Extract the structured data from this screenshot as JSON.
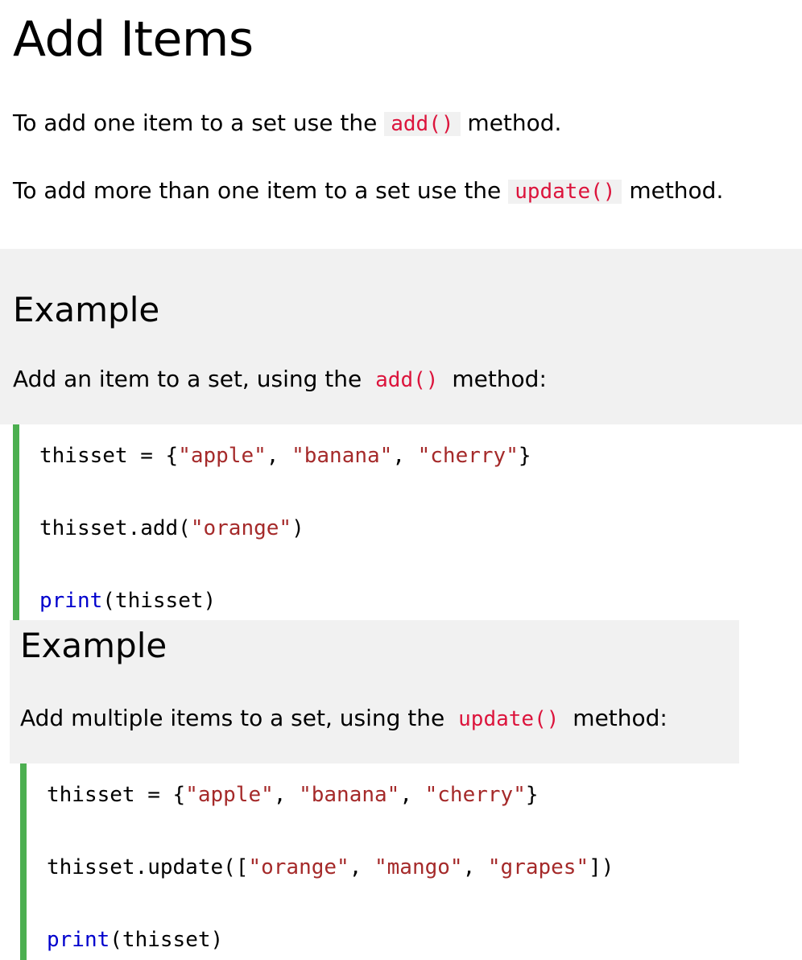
{
  "section": {
    "title": "Add Items",
    "para1": {
      "before": "To add one item to a set use the",
      "code": "add()",
      "after": "method."
    },
    "para2": {
      "before": "To add more than one item to a set use the",
      "code": "update()",
      "after": "method."
    }
  },
  "example1": {
    "heading": "Example",
    "desc_before": "Add an item to a set, using the",
    "desc_code": "add()",
    "desc_after": "method:",
    "code": {
      "line1": {
        "var": "thisset = {",
        "s1": "\"apple\"",
        "c1": ", ",
        "s2": "\"banana\"",
        "c2": ", ",
        "s3": "\"cherry\"",
        "end": "}"
      },
      "line2": {
        "pre": "thisset.add(",
        "s1": "\"orange\"",
        "end": ")"
      },
      "line3": {
        "kw": "print",
        "rest": "(thisset)"
      }
    }
  },
  "example2": {
    "heading": "Example",
    "desc_before": "Add multiple items to a set, using the",
    "desc_code": "update()",
    "desc_after": "method:",
    "code": {
      "line1": {
        "var": "thisset = {",
        "s1": "\"apple\"",
        "c1": ", ",
        "s2": "\"banana\"",
        "c2": ", ",
        "s3": "\"cherry\"",
        "end": "}"
      },
      "line2": {
        "pre": "thisset.update([",
        "s1": "\"orange\"",
        "c1": ", ",
        "s2": "\"mango\"",
        "c2": ", ",
        "s3": "\"grapes\"",
        "end": "])"
      },
      "line3": {
        "kw": "print",
        "rest": "(thisset)"
      }
    }
  },
  "colors": {
    "inline_code": "#dc143c",
    "string": "#a52a2a",
    "keyword": "#0000cd",
    "code_border": "#4caf50",
    "example_bg": "#f1f1f1"
  }
}
